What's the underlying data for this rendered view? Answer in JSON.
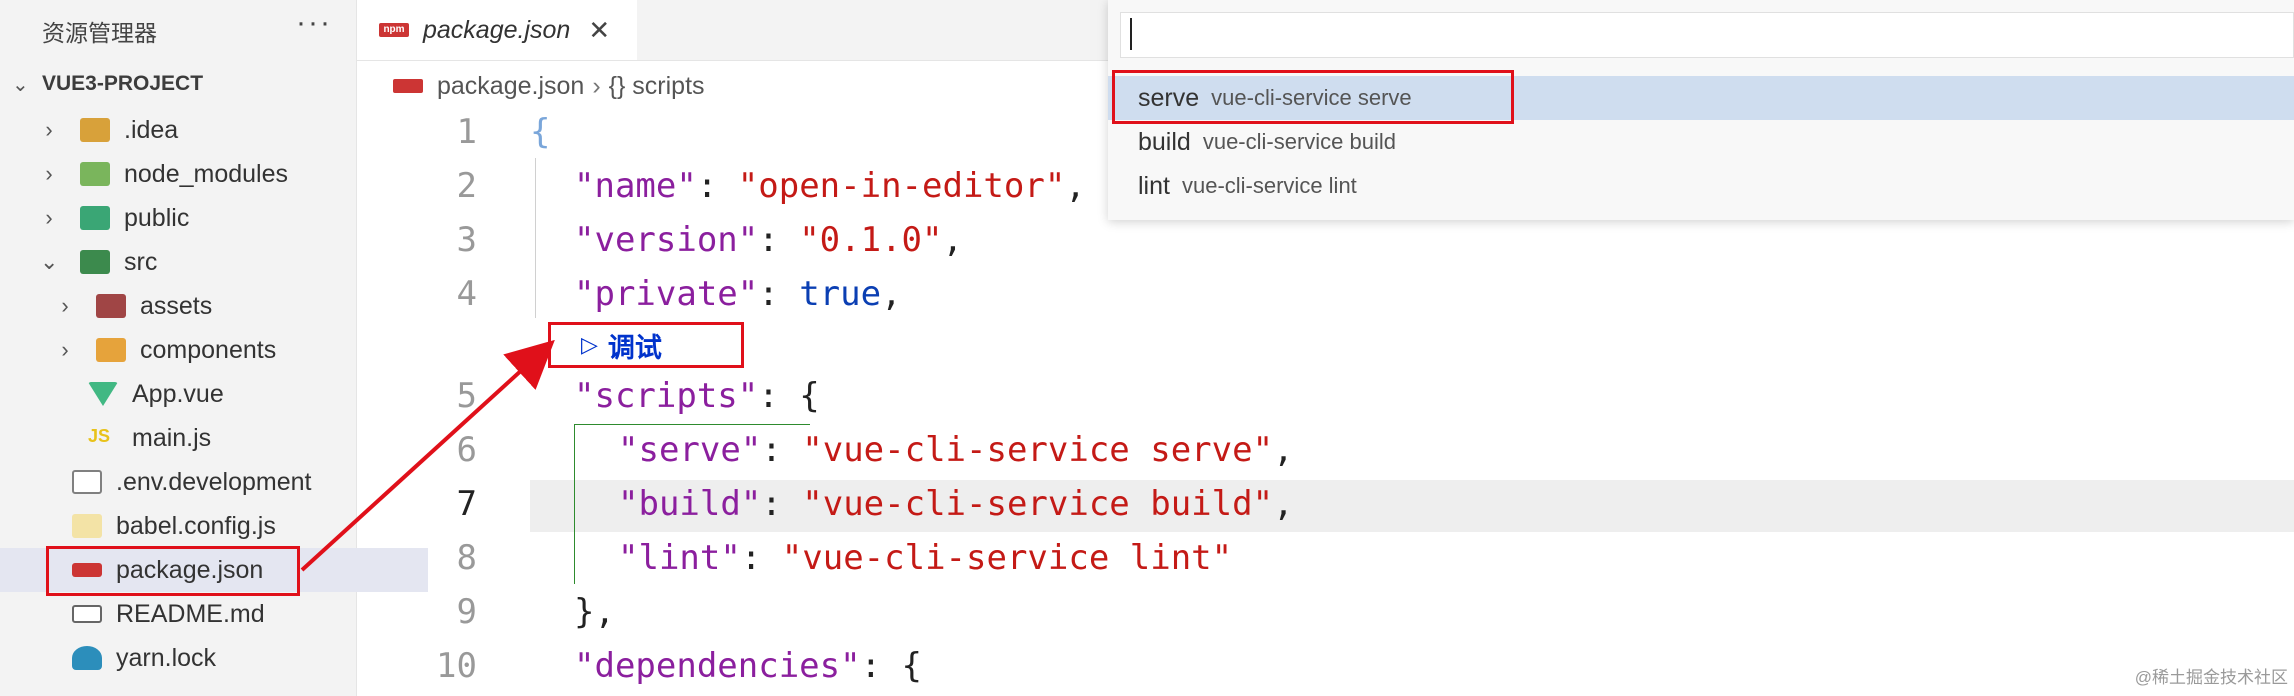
{
  "sidebar": {
    "title": "资源管理器",
    "more": "···",
    "project": "VUE3-PROJECT",
    "items": [
      {
        "label": ".idea",
        "chevron": "›",
        "icon": "folder-idea-icon",
        "color": "#d8a13a"
      },
      {
        "label": "node_modules",
        "chevron": "›",
        "icon": "folder-node-icon",
        "color": "#7ab55c"
      },
      {
        "label": "public",
        "chevron": "›",
        "icon": "folder-public-icon",
        "color": "#3aa675"
      },
      {
        "label": "src",
        "chevron": "⌄",
        "icon": "folder-src-icon",
        "color": "#3c8a4d"
      },
      {
        "label": "assets",
        "chevron": "›",
        "icon": "folder-assets-icon",
        "color": "#a04545"
      },
      {
        "label": "components",
        "chevron": "›",
        "icon": "folder-components-icon",
        "color": "#e6a33b"
      },
      {
        "label": "App.vue",
        "chevron": "",
        "icon": "vue-icon",
        "color": "#41b883"
      },
      {
        "label": "main.js",
        "chevron": "",
        "icon": "js-icon",
        "color": "#e8c21a"
      },
      {
        "label": ".env.development",
        "chevron": "",
        "icon": "terminal-icon",
        "color": "#808080"
      },
      {
        "label": "babel.config.js",
        "chevron": "",
        "icon": "babel-icon",
        "color": "#e8c95b"
      },
      {
        "label": "package.json",
        "chevron": "",
        "icon": "npm-icon",
        "color": "#cc3534"
      },
      {
        "label": "README.md",
        "chevron": "",
        "icon": "markdown-icon",
        "color": "#666666"
      },
      {
        "label": "yarn.lock",
        "chevron": "",
        "icon": "yarn-icon",
        "color": "#2c8ebb"
      }
    ]
  },
  "tab": {
    "label": "package.json",
    "icon_text": "npm",
    "close": "✕"
  },
  "breadcrumb": {
    "file": "package.json",
    "sep": "›",
    "section": "{} scripts"
  },
  "codelens": {
    "play": "▷",
    "label": "调试"
  },
  "line_numbers": [
    "1",
    "2",
    "3",
    "4",
    "5",
    "6",
    "7",
    "8",
    "9",
    "10"
  ],
  "code": {
    "l1": {
      "brace": "{"
    },
    "l2": {
      "key": "\"name\"",
      "colon": ": ",
      "val": "\"open-in-editor\"",
      "tail": ","
    },
    "l3": {
      "key": "\"version\"",
      "colon": ": ",
      "val": "\"0.1.0\"",
      "tail": ","
    },
    "l4": {
      "key": "\"private\"",
      "colon": ": ",
      "val": "true",
      "tail": ","
    },
    "l5": {
      "key": "\"scripts\"",
      "colon": ": ",
      "val": "{"
    },
    "l6": {
      "key": "\"serve\"",
      "colon": ": ",
      "val": "\"vue-cli-service serve\"",
      "tail": ","
    },
    "l7": {
      "key": "\"build\"",
      "colon": ": ",
      "val": "\"vue-cli-service build\"",
      "tail": ","
    },
    "l8": {
      "key": "\"lint\"",
      "colon": ": ",
      "val": "\"vue-cli-service lint\""
    },
    "l9": {
      "brace": "},"
    },
    "l10": {
      "key": "\"dependencies\"",
      "colon": ": ",
      "val": "{"
    }
  },
  "quickpick": {
    "input_value": "",
    "items": [
      {
        "name": "serve",
        "desc": "vue-cli-service serve"
      },
      {
        "name": "build",
        "desc": "vue-cli-service build"
      },
      {
        "name": "lint",
        "desc": "vue-cli-service lint"
      }
    ]
  },
  "watermark": "@稀土掘金技术社区",
  "colors": {
    "highlight_box": "#e0101a",
    "selection": "#cfddef",
    "key": "#8b1f9e",
    "string": "#c41a16",
    "boolean": "#0b3fb3"
  }
}
